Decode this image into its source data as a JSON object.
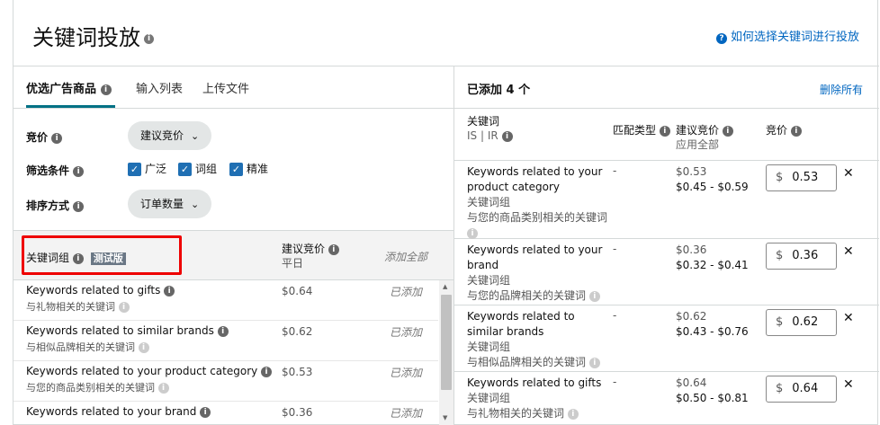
{
  "header": {
    "title": "关键词投放",
    "help_link": "如何选择关键词进行投放"
  },
  "left": {
    "tabs": [
      {
        "label": "优选广告商品",
        "active": true
      },
      {
        "label": "输入列表",
        "active": false
      },
      {
        "label": "上传文件",
        "active": false
      }
    ],
    "bid_label": "竞价",
    "bid_select": "建议竞价",
    "filter_label": "筛选条件",
    "filter_options": [
      "广泛",
      "词组",
      "精准"
    ],
    "sort_label": "排序方式",
    "sort_select": "订单数量",
    "kw_group_label": "关键词组",
    "beta_badge": "测试版",
    "suggested_bid_label": "建议竞价",
    "suggested_bid_sub": "平日",
    "add_all": "添加全部",
    "suggestions": [
      {
        "en": "Keywords related to gifts",
        "zh": "与礼物相关的关键词",
        "price": "$0.64",
        "status": "已添加"
      },
      {
        "en": "Keywords related to similar brands",
        "zh": "与相似品牌相关的关键词",
        "price": "$0.62",
        "status": "已添加"
      },
      {
        "en": "Keywords related to your product category",
        "zh": "与您的商品类别相关的关键词",
        "price": "$0.53",
        "status": "已添加"
      },
      {
        "en": "Keywords related to your brand",
        "zh": "",
        "price": "$0.36",
        "status": "已添加"
      }
    ]
  },
  "right": {
    "title": "已添加 4 个",
    "remove_all": "删除所有",
    "col_keyword": "关键词",
    "col_keyword_sub": "IS | IR",
    "col_match": "匹配类型",
    "col_sugg_bid": "建议竞价",
    "col_sugg_bid_sub": "应用全部",
    "col_bid": "竞价",
    "currency": "$",
    "added": [
      {
        "en": "Keywords related to your product category",
        "group": "关键词组",
        "zh": "与您的商品类别相关的关键词",
        "match": "-",
        "bid": "$0.53",
        "range": "$0.45 - $0.59",
        "value": "0.53"
      },
      {
        "en": "Keywords related to your brand",
        "group": "关键词组",
        "zh": "与您的品牌相关的关键词",
        "match": "-",
        "bid": "$0.36",
        "range": "$0.32 - $0.41",
        "value": "0.36"
      },
      {
        "en": "Keywords related to similar brands",
        "group": "关键词组",
        "zh": "与相似品牌相关的关键词",
        "match": "-",
        "bid": "$0.62",
        "range": "$0.43 - $0.76",
        "value": "0.62"
      },
      {
        "en": "Keywords related to gifts",
        "group": "关键词组",
        "zh": "与礼物相关的关键词",
        "match": "-",
        "bid": "$0.64",
        "range": "$0.50 - $0.81",
        "value": "0.64"
      }
    ]
  }
}
